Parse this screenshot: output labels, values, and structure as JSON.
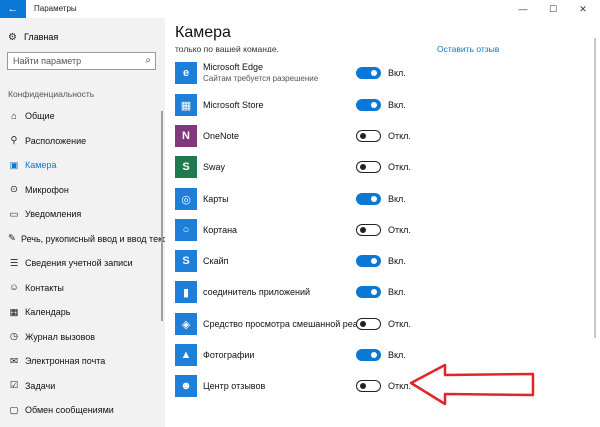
{
  "window": {
    "title": "Параметры",
    "back_icon": "back-arrow-icon",
    "controls": [
      "—",
      "☐",
      "✕"
    ]
  },
  "sidebar": {
    "home_label": "Главная",
    "search_placeholder": "Найти параметр",
    "section_label": "Конфиденциальность",
    "items": [
      {
        "label": "Общие",
        "icon": "lock-icon",
        "glyph": "⌂",
        "active": false
      },
      {
        "label": "Расположение",
        "icon": "location-icon",
        "glyph": "⚲",
        "active": false
      },
      {
        "label": "Камера",
        "icon": "camera-icon",
        "glyph": "▣",
        "active": true
      },
      {
        "label": "Микрофон",
        "icon": "microphone-icon",
        "glyph": "⊙",
        "active": false
      },
      {
        "label": "Уведомления",
        "icon": "notifications-icon",
        "glyph": "▭",
        "active": false
      },
      {
        "label": "Речь, рукописный ввод и ввод текста",
        "icon": "speech-icon",
        "glyph": "✎",
        "active": false
      },
      {
        "label": "Сведения учетной записи",
        "icon": "account-info-icon",
        "glyph": "☰",
        "active": false
      },
      {
        "label": "Контакты",
        "icon": "contacts-icon",
        "glyph": "☺",
        "active": false
      },
      {
        "label": "Календарь",
        "icon": "calendar-icon",
        "glyph": "▦",
        "active": false
      },
      {
        "label": "Журнал вызовов",
        "icon": "call-history-icon",
        "glyph": "◷",
        "active": false
      },
      {
        "label": "Электронная почта",
        "icon": "mail-icon",
        "glyph": "✉",
        "active": false
      },
      {
        "label": "Задачи",
        "icon": "tasks-icon",
        "glyph": "☑",
        "active": false
      },
      {
        "label": "Обмен сообщениями",
        "icon": "messaging-icon",
        "glyph": "▢",
        "active": false
      }
    ]
  },
  "main": {
    "title": "Камера",
    "cut_text": "только по вашей команде.",
    "cut_link": "Оставить отзыв",
    "apps": [
      {
        "name": "Microsoft Edge",
        "sub": "Сайтам требуется разрешение",
        "state": "Вкл.",
        "on": true,
        "tile_color": "#1e7fd8",
        "icon": "edge-icon",
        "glyph": "e"
      },
      {
        "name": "Microsoft Store",
        "sub": "",
        "state": "Вкл.",
        "on": true,
        "tile_color": "#1e7fd8",
        "icon": "store-icon",
        "glyph": "▦"
      },
      {
        "name": "OneNote",
        "sub": "",
        "state": "Откл.",
        "on": false,
        "tile_color": "#80397b",
        "icon": "onenote-icon",
        "glyph": "N"
      },
      {
        "name": "Sway",
        "sub": "",
        "state": "Откл.",
        "on": false,
        "tile_color": "#1f7a4f",
        "icon": "sway-icon",
        "glyph": "S"
      },
      {
        "name": "Карты",
        "sub": "",
        "state": "Вкл.",
        "on": true,
        "tile_color": "#1e7fd8",
        "icon": "maps-icon",
        "glyph": "◎"
      },
      {
        "name": "Кортана",
        "sub": "",
        "state": "Откл.",
        "on": false,
        "tile_color": "#1e7fd8",
        "icon": "cortana-icon",
        "glyph": "○"
      },
      {
        "name": "Скайп",
        "sub": "",
        "state": "Вкл.",
        "on": true,
        "tile_color": "#1e7fd8",
        "icon": "skype-icon",
        "glyph": "S"
      },
      {
        "name": "соединитель приложений",
        "sub": "",
        "state": "Вкл.",
        "on": true,
        "tile_color": "#1e7fd8",
        "icon": "app-connector-icon",
        "glyph": "▮"
      },
      {
        "name": "Средство просмотра смешанной реальн...",
        "sub": "",
        "state": "Откл.",
        "on": false,
        "tile_color": "#1e7fd8",
        "icon": "mixed-reality-viewer-icon",
        "glyph": "◈"
      },
      {
        "name": "Фотографии",
        "sub": "",
        "state": "Вкл.",
        "on": true,
        "tile_color": "#1e7fd8",
        "icon": "photos-icon",
        "glyph": "▲"
      },
      {
        "name": "Центр отзывов",
        "sub": "",
        "state": "Откл.",
        "on": false,
        "tile_color": "#1e7fd8",
        "icon": "feedback-hub-icon",
        "glyph": "☻"
      }
    ]
  },
  "annotation": {
    "arrow_icon": "red-arrow-icon",
    "color": "#e0262b"
  }
}
